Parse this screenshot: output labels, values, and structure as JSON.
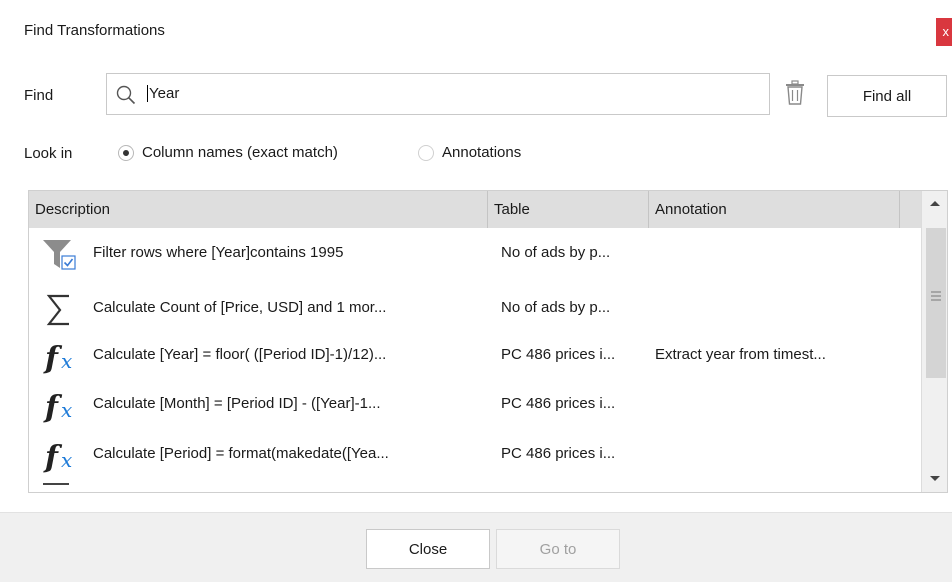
{
  "window": {
    "title": "Find Transformations",
    "close_glyph": "x"
  },
  "find": {
    "label": "Find",
    "value": "Year",
    "find_all_label": "Find all",
    "icons": {
      "search": "search-icon",
      "clear": "trash-icon"
    }
  },
  "look_in": {
    "label": "Look in",
    "options": [
      {
        "label": "Column names (exact match)",
        "selected": true
      },
      {
        "label": "Annotations",
        "selected": false
      }
    ]
  },
  "grid": {
    "columns": [
      "Description",
      "Table",
      "Annotation"
    ],
    "rows": [
      {
        "icon": "filter-checked-icon",
        "description": "Filter rows where [Year]contains 1995",
        "table": "No of ads by p...",
        "annotation": ""
      },
      {
        "icon": "sum-icon",
        "description": "Calculate Count of [Price, USD] and 1 mor...",
        "table": "No of ads by p...",
        "annotation": ""
      },
      {
        "icon": "fx-icon",
        "description": "Calculate [Year] = floor( ([Period ID]-1)/12)...",
        "table": "PC 486 prices i...",
        "annotation": "Extract year from timest..."
      },
      {
        "icon": "fx-icon",
        "description": "Calculate [Month] = [Period ID] - ([Year]-1...",
        "table": "PC 486 prices i...",
        "annotation": ""
      },
      {
        "icon": "fx-icon",
        "description": "Calculate [Period] = format(makedate([Yea...",
        "table": "PC 486 prices i...",
        "annotation": ""
      }
    ]
  },
  "footer": {
    "close_label": "Close",
    "goto_label": "Go to"
  },
  "colors": {
    "accent_fx": "#1e7bd8",
    "close_red": "#d9373f",
    "header_bg": "#dedede",
    "footer_bg": "#f0f0f0"
  }
}
